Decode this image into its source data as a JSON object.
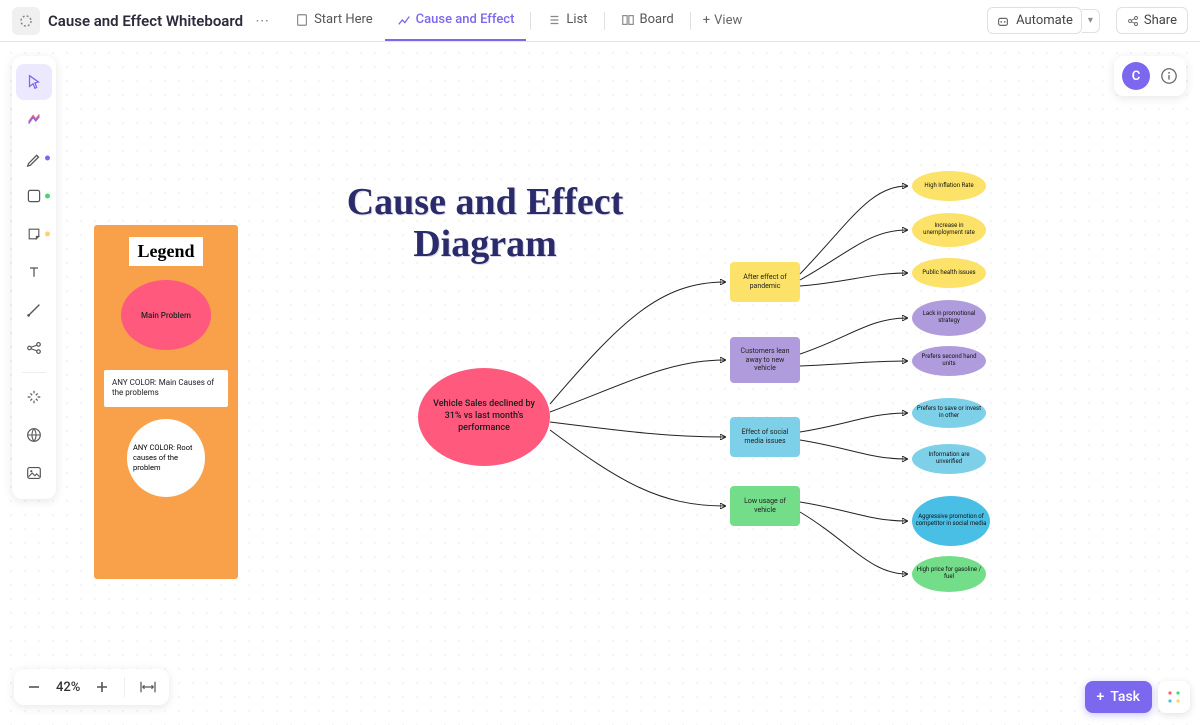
{
  "header": {
    "title": "Cause and Effect Whiteboard",
    "tabs": {
      "start": "Start Here",
      "cause": "Cause and Effect",
      "list": "List",
      "board": "Board"
    },
    "view": "View",
    "automate": "Automate",
    "share": "Share"
  },
  "avatar": "C",
  "zoom": {
    "value": "42%"
  },
  "task_button": "Task",
  "diagram": {
    "title": "Cause and Effect Diagram",
    "legend": {
      "heading": "Legend",
      "main": "Main Problem",
      "causes": "ANY COLOR: Main Causes of the problems",
      "roots": "ANY COLOR: Root causes of the problem"
    },
    "main_problem": "Vehicle Sales declined by 31% vs last month's performance",
    "causes": [
      "After effect of pandemic",
      "Customers lean away to new vehicle",
      "Effect of social media issues",
      "Low usage of vehicle"
    ],
    "roots": [
      "High Inflation Rate",
      "Increase in unemployment rate",
      "Public health issues",
      "Lack in promotional strategy",
      "Prefers second hand units",
      "Prefers to save or invest in other",
      "Information are unverified",
      "Aggressive promotion of competitor in social media",
      "High price for gasoline / fuel"
    ]
  }
}
